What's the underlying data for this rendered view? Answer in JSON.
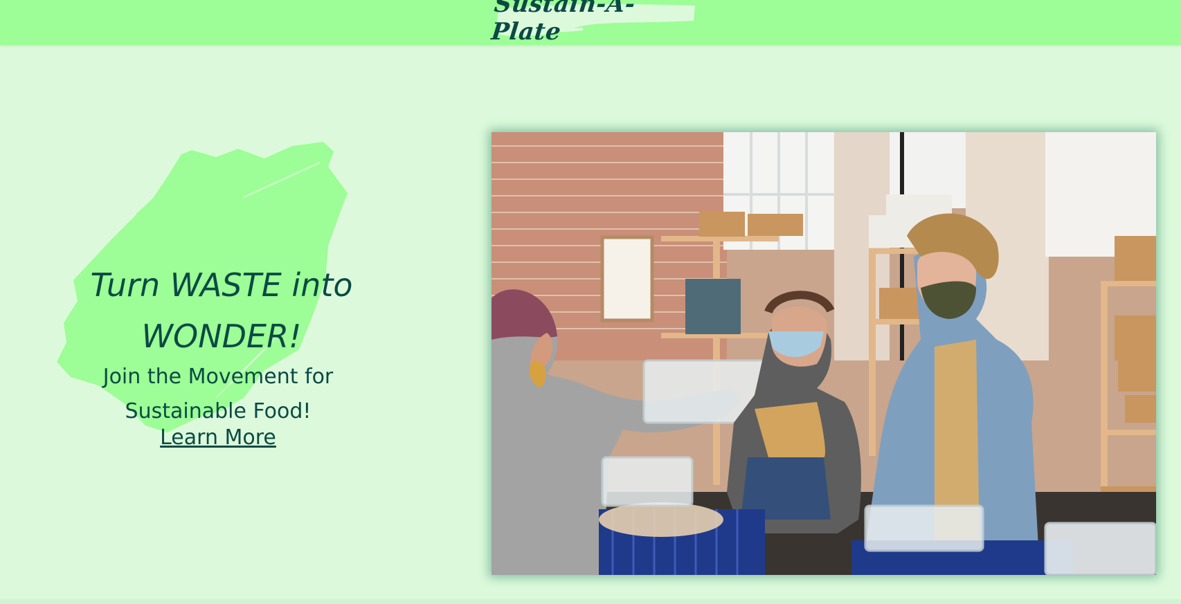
{
  "header": {
    "logo_text": "Sustain-A-Plate",
    "background_color": "#9dfd96"
  },
  "hero": {
    "headline": "Turn WASTE into WONDER!",
    "subheadline": "Join the Movement for Sustainable Food!",
    "cta_label": "Learn More",
    "text_color": "#0b4a44",
    "brush_color": "#9dfd96"
  },
  "photo": {
    "subject": "volunteers at a food bank passing a container of food",
    "icon": "photo-icon"
  },
  "page": {
    "background_color": "#dcfadb"
  }
}
